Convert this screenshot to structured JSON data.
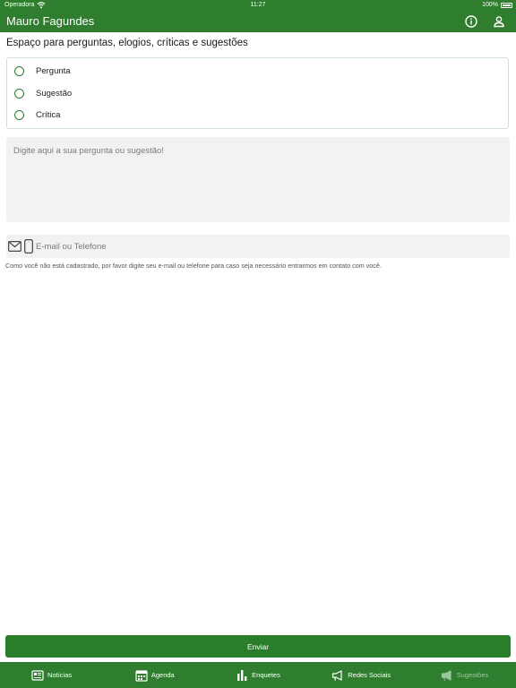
{
  "status_bar": {
    "carrier": "Operadora",
    "time": "11:27",
    "battery": "100%"
  },
  "nav": {
    "title": "Mauro Fagundes",
    "icons": [
      "info-icon",
      "user-icon"
    ]
  },
  "page": {
    "heading": "Espaço para perguntas, elogios, críticas e sugestões"
  },
  "options": [
    {
      "label": "Pergunta"
    },
    {
      "label": "Sugestão"
    },
    {
      "label": "Crítica"
    }
  ],
  "question": {
    "placeholder": "Digite aqui a sua pergunta ou sugestão!",
    "value": ""
  },
  "contact": {
    "placeholder": "E-mail ou Telefone",
    "value": "",
    "icons": [
      "mail-icon",
      "phone-icon"
    ],
    "notice": "Como você não está cadastrado, por favor digite seu e-mail ou telefone para caso seja necessário entrarmos em contato com você."
  },
  "send_button": {
    "label": "Enviar"
  },
  "tabs": [
    {
      "label": "Notícias",
      "icon": "newspaper-icon",
      "active": false
    },
    {
      "label": "Agenda",
      "icon": "calendar-icon",
      "active": false
    },
    {
      "label": "Enquetes",
      "icon": "bar-chart-icon",
      "active": false
    },
    {
      "label": "Redes Sociais",
      "icon": "megaphone-icon",
      "active": false
    },
    {
      "label": "Sugestões",
      "icon": "megaphone-icon",
      "active": true
    }
  ],
  "colors": {
    "brand_green": "#2f7d2f",
    "button_green": "#2a7d2a",
    "active_tab": "#9cc79c",
    "field_background": "#f2f2f2"
  }
}
